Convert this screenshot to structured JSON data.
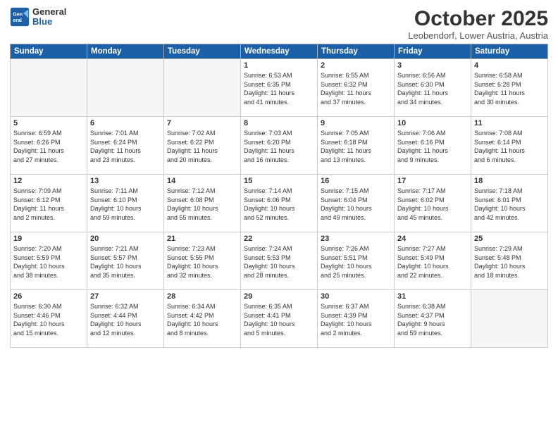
{
  "header": {
    "logo_general": "General",
    "logo_blue": "Blue",
    "month_title": "October 2025",
    "location": "Leobendorf, Lower Austria, Austria"
  },
  "weekdays": [
    "Sunday",
    "Monday",
    "Tuesday",
    "Wednesday",
    "Thursday",
    "Friday",
    "Saturday"
  ],
  "weeks": [
    [
      {
        "day": "",
        "info": ""
      },
      {
        "day": "",
        "info": ""
      },
      {
        "day": "",
        "info": ""
      },
      {
        "day": "1",
        "info": "Sunrise: 6:53 AM\nSunset: 6:35 PM\nDaylight: 11 hours\nand 41 minutes."
      },
      {
        "day": "2",
        "info": "Sunrise: 6:55 AM\nSunset: 6:32 PM\nDaylight: 11 hours\nand 37 minutes."
      },
      {
        "day": "3",
        "info": "Sunrise: 6:56 AM\nSunset: 6:30 PM\nDaylight: 11 hours\nand 34 minutes."
      },
      {
        "day": "4",
        "info": "Sunrise: 6:58 AM\nSunset: 6:28 PM\nDaylight: 11 hours\nand 30 minutes."
      }
    ],
    [
      {
        "day": "5",
        "info": "Sunrise: 6:59 AM\nSunset: 6:26 PM\nDaylight: 11 hours\nand 27 minutes."
      },
      {
        "day": "6",
        "info": "Sunrise: 7:01 AM\nSunset: 6:24 PM\nDaylight: 11 hours\nand 23 minutes."
      },
      {
        "day": "7",
        "info": "Sunrise: 7:02 AM\nSunset: 6:22 PM\nDaylight: 11 hours\nand 20 minutes."
      },
      {
        "day": "8",
        "info": "Sunrise: 7:03 AM\nSunset: 6:20 PM\nDaylight: 11 hours\nand 16 minutes."
      },
      {
        "day": "9",
        "info": "Sunrise: 7:05 AM\nSunset: 6:18 PM\nDaylight: 11 hours\nand 13 minutes."
      },
      {
        "day": "10",
        "info": "Sunrise: 7:06 AM\nSunset: 6:16 PM\nDaylight: 11 hours\nand 9 minutes."
      },
      {
        "day": "11",
        "info": "Sunrise: 7:08 AM\nSunset: 6:14 PM\nDaylight: 11 hours\nand 6 minutes."
      }
    ],
    [
      {
        "day": "12",
        "info": "Sunrise: 7:09 AM\nSunset: 6:12 PM\nDaylight: 11 hours\nand 2 minutes."
      },
      {
        "day": "13",
        "info": "Sunrise: 7:11 AM\nSunset: 6:10 PM\nDaylight: 10 hours\nand 59 minutes."
      },
      {
        "day": "14",
        "info": "Sunrise: 7:12 AM\nSunset: 6:08 PM\nDaylight: 10 hours\nand 55 minutes."
      },
      {
        "day": "15",
        "info": "Sunrise: 7:14 AM\nSunset: 6:06 PM\nDaylight: 10 hours\nand 52 minutes."
      },
      {
        "day": "16",
        "info": "Sunrise: 7:15 AM\nSunset: 6:04 PM\nDaylight: 10 hours\nand 49 minutes."
      },
      {
        "day": "17",
        "info": "Sunrise: 7:17 AM\nSunset: 6:02 PM\nDaylight: 10 hours\nand 45 minutes."
      },
      {
        "day": "18",
        "info": "Sunrise: 7:18 AM\nSunset: 6:01 PM\nDaylight: 10 hours\nand 42 minutes."
      }
    ],
    [
      {
        "day": "19",
        "info": "Sunrise: 7:20 AM\nSunset: 5:59 PM\nDaylight: 10 hours\nand 38 minutes."
      },
      {
        "day": "20",
        "info": "Sunrise: 7:21 AM\nSunset: 5:57 PM\nDaylight: 10 hours\nand 35 minutes."
      },
      {
        "day": "21",
        "info": "Sunrise: 7:23 AM\nSunset: 5:55 PM\nDaylight: 10 hours\nand 32 minutes."
      },
      {
        "day": "22",
        "info": "Sunrise: 7:24 AM\nSunset: 5:53 PM\nDaylight: 10 hours\nand 28 minutes."
      },
      {
        "day": "23",
        "info": "Sunrise: 7:26 AM\nSunset: 5:51 PM\nDaylight: 10 hours\nand 25 minutes."
      },
      {
        "day": "24",
        "info": "Sunrise: 7:27 AM\nSunset: 5:49 PM\nDaylight: 10 hours\nand 22 minutes."
      },
      {
        "day": "25",
        "info": "Sunrise: 7:29 AM\nSunset: 5:48 PM\nDaylight: 10 hours\nand 18 minutes."
      }
    ],
    [
      {
        "day": "26",
        "info": "Sunrise: 6:30 AM\nSunset: 4:46 PM\nDaylight: 10 hours\nand 15 minutes."
      },
      {
        "day": "27",
        "info": "Sunrise: 6:32 AM\nSunset: 4:44 PM\nDaylight: 10 hours\nand 12 minutes."
      },
      {
        "day": "28",
        "info": "Sunrise: 6:34 AM\nSunset: 4:42 PM\nDaylight: 10 hours\nand 8 minutes."
      },
      {
        "day": "29",
        "info": "Sunrise: 6:35 AM\nSunset: 4:41 PM\nDaylight: 10 hours\nand 5 minutes."
      },
      {
        "day": "30",
        "info": "Sunrise: 6:37 AM\nSunset: 4:39 PM\nDaylight: 10 hours\nand 2 minutes."
      },
      {
        "day": "31",
        "info": "Sunrise: 6:38 AM\nSunset: 4:37 PM\nDaylight: 9 hours\nand 59 minutes."
      },
      {
        "day": "",
        "info": ""
      }
    ]
  ]
}
